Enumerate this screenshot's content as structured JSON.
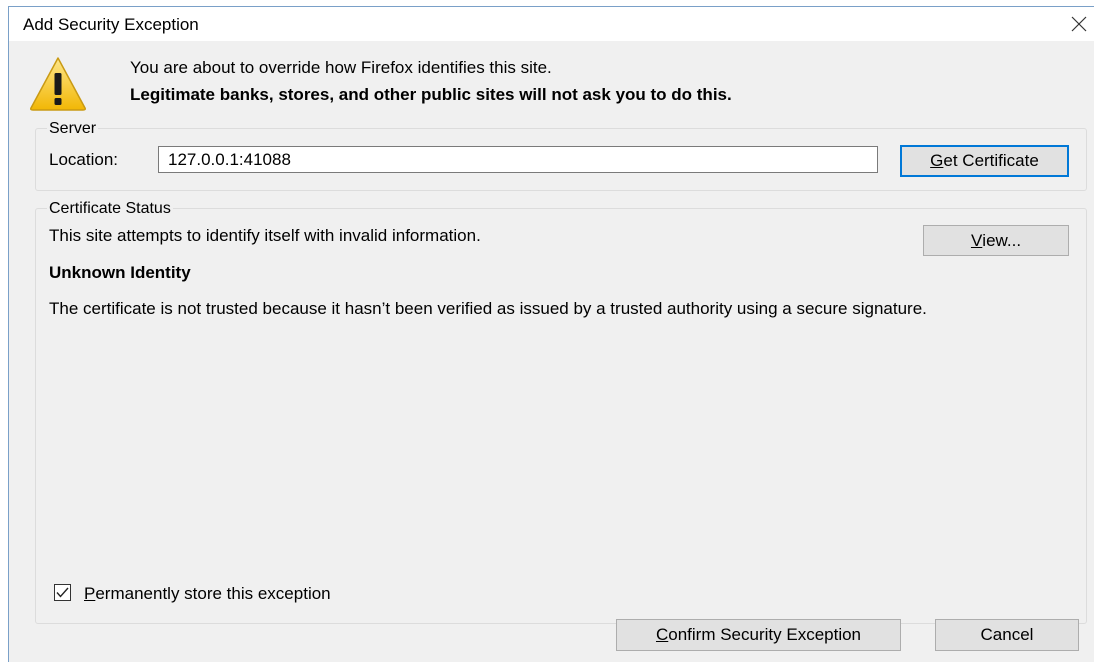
{
  "dialog": {
    "title": "Add Security Exception",
    "close_icon": "close-icon",
    "warning_icon": "warning-triangle-icon"
  },
  "header": {
    "line1": "You are about to override how Firefox identifies this site.",
    "line2": "Legitimate banks, stores, and other public sites will not ask you to do this."
  },
  "server": {
    "group_label": "Server",
    "location_label": "Location:",
    "location_value": "127.0.0.1:41088",
    "get_certificate_accel": "G",
    "get_certificate_rest": "et Certificate"
  },
  "certificate_status": {
    "group_label": "Certificate Status",
    "status_text": "This site attempts to identify itself with invalid information.",
    "view_accel": "V",
    "view_rest": "iew...",
    "identity_heading": "Unknown Identity",
    "description": "The certificate is not trusted because it hasn’t been verified as issued by a trusted authority using a secure signature."
  },
  "permanent": {
    "checked": true,
    "label_accel": "P",
    "label_rest": "ermanently store this exception"
  },
  "footer": {
    "confirm_accel": "C",
    "confirm_rest": "onfirm Security Exception",
    "cancel_label": "Cancel"
  },
  "colors": {
    "dialog_bg": "#f0f0f0",
    "titlebar_bg": "#ffffff",
    "button_bg": "#e1e1e1",
    "default_button_border": "#0078d7",
    "warning_yellow": "#f7c431"
  }
}
